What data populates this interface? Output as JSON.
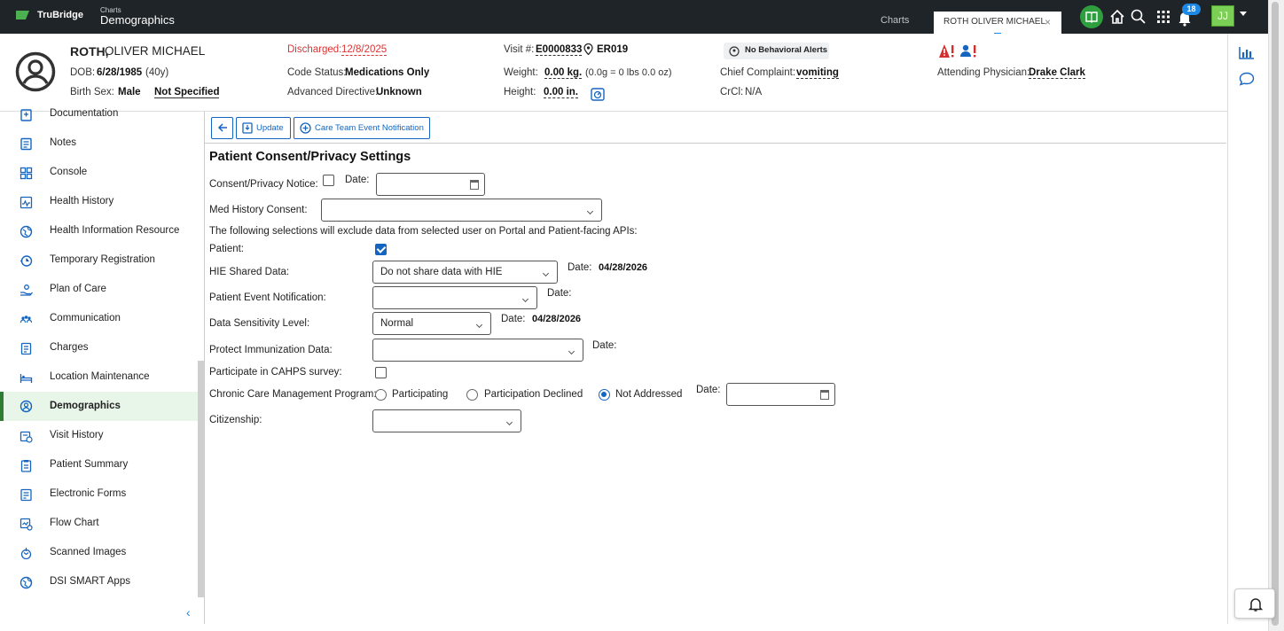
{
  "app": {
    "logo_text": "TruBridge",
    "breadcrumb_parent": "Charts",
    "breadcrumb_title": "Demographics"
  },
  "tabs": {
    "charts_label": "Charts",
    "patient_tab_label": "ROTH OLIVER MICHAEL"
  },
  "topbar": {
    "notification_count": "18",
    "user_initials": "JJ"
  },
  "patient": {
    "last_name": "ROTH,",
    "first_names": "OLIVER MICHAEL",
    "dob_label": "DOB:",
    "dob": "6/28/1985",
    "age": "(40y)",
    "sex_label": "Birth Sex:",
    "sex": "Male",
    "sex_extra": "Not Specified",
    "discharged_label": "Discharged:",
    "discharged": "12/8/2025",
    "code_status_label": "Code Status:",
    "code_status": "Medications Only",
    "adv_directive_label": "Advanced Directive:",
    "adv_directive": "Unknown",
    "visit_label": "Visit #:",
    "visit": "E0000833",
    "location": "ER019",
    "weight_label": "Weight:",
    "weight": "0.00 kg.",
    "weight_conv": "(0.0g = 0 lbs 0.0 oz)",
    "height_label": "Height:",
    "height": "0.00 in.",
    "behavioral": "No Behavioral Alerts",
    "complaint_label": "Chief Complaint:",
    "complaint": "vomiting",
    "crcl_label": "CrCl:",
    "crcl": "N/A",
    "physician_label": "Attending Physician:",
    "physician": "Drake Clark"
  },
  "sidebar": {
    "items": [
      {
        "label": "Documentation"
      },
      {
        "label": "Notes"
      },
      {
        "label": "Console"
      },
      {
        "label": "Health History"
      },
      {
        "label": "Health Information Resource"
      },
      {
        "label": "Temporary Registration"
      },
      {
        "label": "Plan of Care"
      },
      {
        "label": "Communication"
      },
      {
        "label": "Charges"
      },
      {
        "label": "Location Maintenance"
      },
      {
        "label": "Demographics"
      },
      {
        "label": "Visit History"
      },
      {
        "label": "Patient Summary"
      },
      {
        "label": "Electronic Forms"
      },
      {
        "label": "Flow Chart"
      },
      {
        "label": "Scanned Images"
      },
      {
        "label": "DSI SMART Apps"
      }
    ]
  },
  "toolbar": {
    "update_label": "Update",
    "notify_label": "Care Team Event Notification"
  },
  "form": {
    "title": "Patient Consent/Privacy Settings",
    "consent_label": "Consent/Privacy Notice:",
    "date_label": "Date:",
    "med_history_label": "Med History Consent:",
    "exclusion_note": "The following selections will exclude data from selected user on Portal and Patient-facing APIs:",
    "patient_label": "Patient:",
    "hie_label": "HIE Shared Data:",
    "hie_value": "Do not share data with HIE",
    "hie_date": "04/28/2026",
    "event_label": "Patient Event Notification:",
    "sensitivity_label": "Data Sensitivity Level:",
    "sensitivity_value": "Normal",
    "sensitivity_date": "04/28/2026",
    "immunization_label": "Protect Immunization Data:",
    "cahps_label": "Participate in CAHPS survey:",
    "ccm_label": "Chronic Care Management Program:",
    "ccm_options": [
      "Participating",
      "Participation Declined",
      "Not Addressed"
    ],
    "citizenship_label": "Citizenship:"
  },
  "colors": {
    "accent": "#1565c0",
    "topbar": "#1f2428",
    "active_nav": "#e8f5e9",
    "alert_red": "#d33"
  }
}
